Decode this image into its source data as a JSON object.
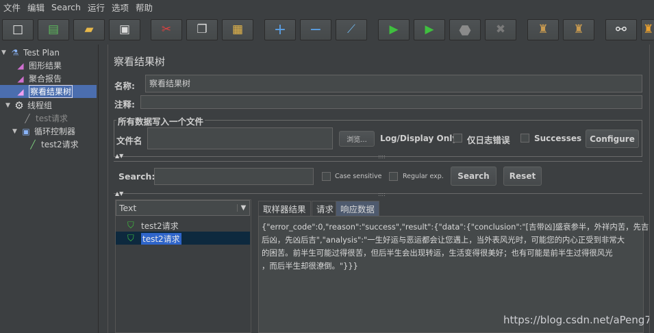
{
  "menu": [
    "文件",
    "编辑",
    "Search",
    "运行",
    "选项",
    "帮助"
  ],
  "toolbar": [
    {
      "icon": "new-icon",
      "glyph": "□"
    },
    {
      "icon": "templates-icon",
      "glyph": "▤"
    },
    {
      "icon": "open-icon",
      "glyph": "▰"
    },
    {
      "icon": "save-icon",
      "glyph": "▣"
    },
    {
      "icon": "cut-icon",
      "glyph": "✂"
    },
    {
      "icon": "copy-icon",
      "glyph": "❐"
    },
    {
      "icon": "paste-icon",
      "glyph": "▦"
    },
    {
      "icon": "expand-icon",
      "glyph": "+"
    },
    {
      "icon": "collapse-icon",
      "glyph": "−"
    },
    {
      "icon": "toggle-icon",
      "glyph": "⟋"
    },
    {
      "icon": "start-icon",
      "glyph": "▶"
    },
    {
      "icon": "start-no-pauses-icon",
      "glyph": "▶"
    },
    {
      "icon": "stop-icon",
      "glyph": "⬣"
    },
    {
      "icon": "shutdown-icon",
      "glyph": "✖"
    },
    {
      "icon": "clear-icon",
      "glyph": "♜"
    },
    {
      "icon": "clear-all-icon",
      "glyph": "♜"
    },
    {
      "icon": "search-icon",
      "glyph": "⚯"
    },
    {
      "icon": "reset-search-icon",
      "glyph": "♜"
    }
  ],
  "tree": {
    "items": [
      {
        "label": "Test Plan",
        "icon": "test-plan-icon",
        "glyph": "⚗"
      },
      {
        "label": "图形结果",
        "icon": "graph-results-icon",
        "glyph": "◢"
      },
      {
        "label": "聚合报告",
        "icon": "aggregate-report-icon",
        "glyph": "◢"
      },
      {
        "label": "察看结果树",
        "icon": "results-tree-icon",
        "glyph": "◢"
      },
      {
        "label": "线程组",
        "icon": "thread-group-icon",
        "glyph": "⚙"
      },
      {
        "label": "test请求",
        "icon": "sampler-icon",
        "glyph": "╱"
      },
      {
        "label": "循环控制器",
        "icon": "loop-controller-icon",
        "glyph": "▣"
      },
      {
        "label": "test2请求",
        "icon": "sampler-icon",
        "glyph": "╱"
      }
    ]
  },
  "panel": {
    "title": "察看结果树",
    "name_label": "名称:",
    "name_value": "察看结果树",
    "comment_label": "注释:",
    "comment_value": "",
    "file_section_label": "所有数据写入一个文件",
    "filename_label": "文件名",
    "filename_value": "",
    "browse_label": "浏览...",
    "log_display_label": "Log/Display Only:",
    "errors_only_label": "仅日志错误",
    "successes_label": "Successes",
    "configure_label": "Configure"
  },
  "search": {
    "label": "Search:",
    "value": "",
    "case_sensitive_label": "Case sensitive",
    "regex_label": "Regular exp.",
    "search_button": "Search",
    "reset_button": "Reset"
  },
  "results": {
    "renderer": "Text",
    "samples": [
      "test2请求",
      "test2请求"
    ],
    "tabs": [
      "取样器结果",
      "请求",
      "响应数据"
    ],
    "response_lines": [
      "{\"error_code\":0,\"reason\":\"success\",\"result\":{\"data\":{\"conclusion\":\"[吉带凶]盛衰参半，外祥内苦，先吉",
      "后凶，先凶后吉\",\"analysis\":\"一生好运与恶运都会让您遇上，当外表风光时，可能您的内心正受到非常大",
      "的困苦。前半生可能过得很苦，但后半生会出现转运，生活变得很美好；也有可能是前半生过得很风光",
      "，而后半生却很潦倒。\"}}}"
    ]
  },
  "watermark": "https://blog.csdn.net/aPeng7",
  "colors": {
    "accent_selected": "#4b6eaf",
    "success_check": "#3fbf3f"
  }
}
